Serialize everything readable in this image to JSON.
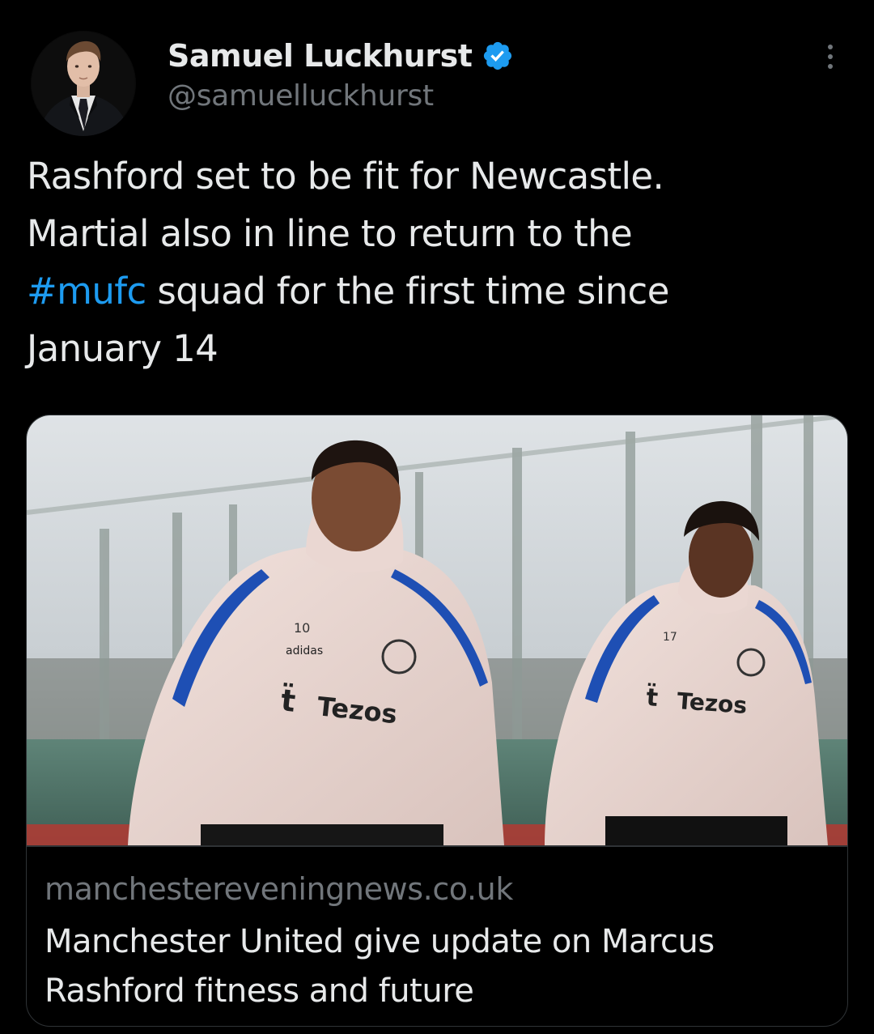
{
  "author": {
    "display_name": "Samuel Luckhurst",
    "handle": "@samuelluckhurst",
    "verified": true,
    "avatar_icon": "person-in-suit-avatar"
  },
  "tweet": {
    "text_lines": [
      [
        "Rashford set to be fit for Newcastle."
      ],
      [
        "Martial also in line to return to the"
      ],
      [
        "",
        "#mufc",
        " squad for the first time since"
      ],
      [
        "January 14"
      ]
    ],
    "hashtag": "#mufc"
  },
  "card": {
    "image_description_icon": "two-players-training-photo",
    "jersey_sponsor_left": "Tezos",
    "jersey_sponsor_right": "Tezos",
    "jersey_brand": "adidas",
    "jersey_number_left": "10",
    "jersey_number_right": "17",
    "domain": "manchestereveningnews.co.uk",
    "title_lines": [
      "Manchester United give update on Marcus",
      "Rashford fitness and future"
    ]
  },
  "colors": {
    "background": "#000000",
    "text": "#e7e9ea",
    "secondary": "#71767b",
    "accent": "#1d9bf0",
    "border": "#2f3336"
  }
}
